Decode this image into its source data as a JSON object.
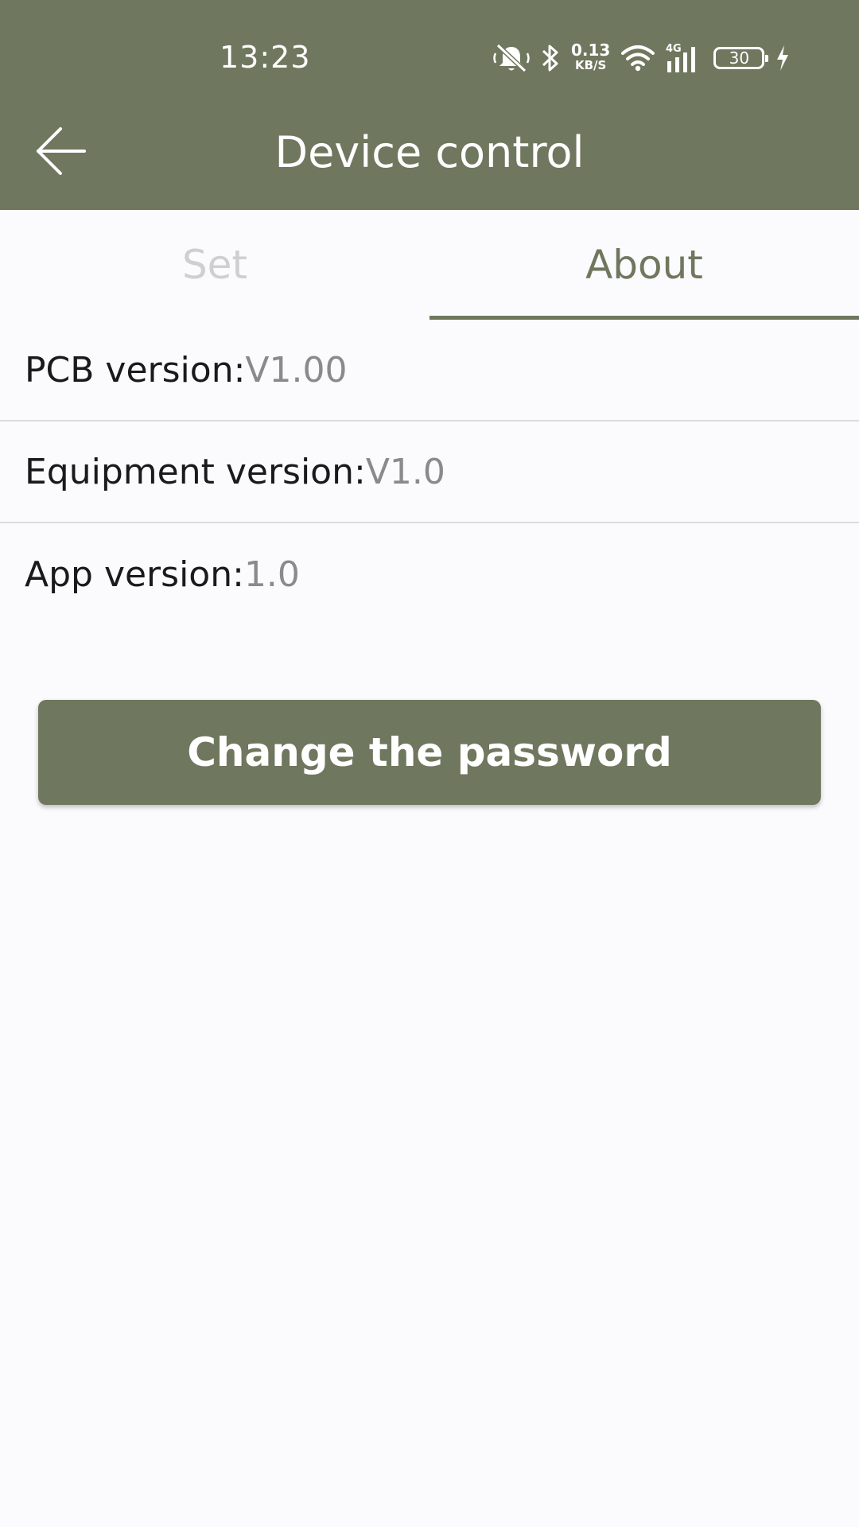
{
  "status_bar": {
    "time": "13:23",
    "net_speed_value": "0.13",
    "net_speed_unit": "KB/S",
    "network_type": "4G",
    "battery_level": "30",
    "icons": [
      "bell-off-icon",
      "bluetooth-icon",
      "wifi-icon",
      "signal-icon",
      "battery-icon",
      "charging-icon"
    ]
  },
  "header": {
    "title": "Device control",
    "back_icon": "arrow-left-icon"
  },
  "tabs": [
    {
      "label": "Set",
      "active": false
    },
    {
      "label": "About",
      "active": true
    }
  ],
  "about": {
    "pcb_label": "PCB version:",
    "pcb_value": "V1.00",
    "equipment_label": "Equipment version:",
    "equipment_value": "V1.0",
    "app_label": "App version:",
    "app_value": "1.0"
  },
  "actions": {
    "change_password_label": "Change the password"
  },
  "colors": {
    "primary": "#6f775e",
    "background": "#fbfafc",
    "inactive_tab": "#cfcfcf",
    "value_text": "#8a8a8a"
  }
}
